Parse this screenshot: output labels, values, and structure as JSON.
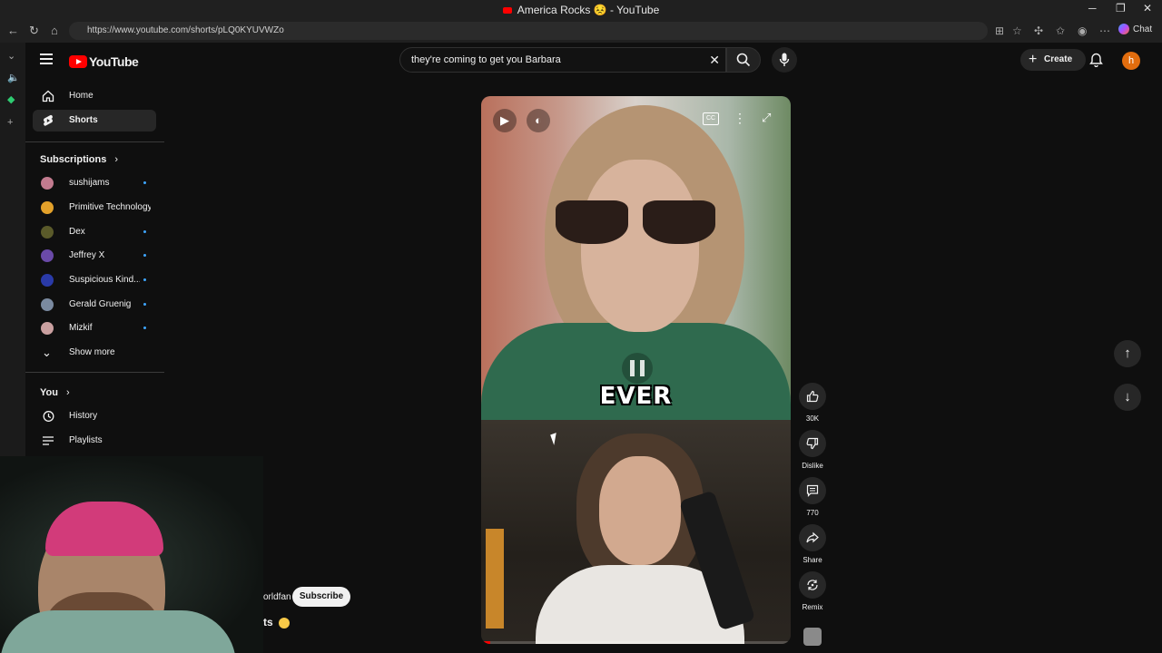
{
  "browser": {
    "window_title": "America Rocks 😣 - YouTube",
    "url": "https://www.youtube.com/shorts/pLQ0KYUVWZo",
    "chat_label": "Chat"
  },
  "header": {
    "logo_text": "YouTube",
    "search_query": "they're coming to get you Barbara",
    "create_label": "Create",
    "avatar_letter": "h"
  },
  "sidebar": {
    "nav": [
      {
        "label": "Home"
      },
      {
        "label": "Shorts"
      }
    ],
    "subscriptions_heading": "Subscriptions",
    "subscriptions": [
      {
        "name": "sushijams",
        "color": "#c27b8f"
      },
      {
        "name": "Primitive Technology",
        "color": "#e3a12a"
      },
      {
        "name": "Dex",
        "color": "#5a5a2a"
      },
      {
        "name": "Jeffrey X",
        "color": "#6a4aa8"
      },
      {
        "name": "Suspicious Kind...",
        "color": "#2a3aa8"
      },
      {
        "name": "Gerald Gruenig",
        "color": "#7a8aa0"
      },
      {
        "name": "Mizkif",
        "color": "#caa0a0"
      }
    ],
    "show_more": "Show more",
    "you_heading": "You",
    "you_items": [
      {
        "label": "History"
      },
      {
        "label": "Playlists"
      }
    ]
  },
  "video": {
    "caption": "EVER",
    "channel_fragment": "orldfan",
    "subscribe_label": "Subscribe",
    "title_fragment": "ts",
    "progress_percent": 3
  },
  "actions": {
    "likes": "30K",
    "dislike_label": "Dislike",
    "comments": "770",
    "share_label": "Share",
    "remix_label": "Remix"
  },
  "colors": {
    "brand_red": "#ff0000",
    "background": "#0f0f0f",
    "accent_blue": "#3ea6ff"
  }
}
